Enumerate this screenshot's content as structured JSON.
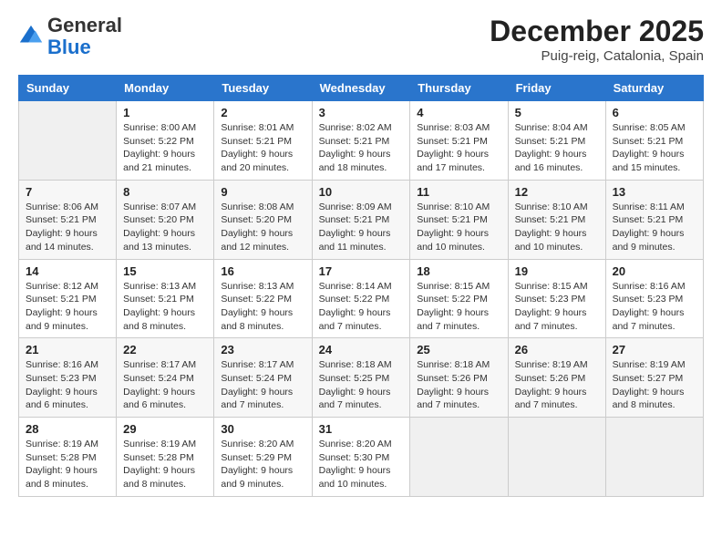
{
  "logo": {
    "general": "General",
    "blue": "Blue"
  },
  "title": "December 2025",
  "location": "Puig-reig, Catalonia, Spain",
  "weekdays": [
    "Sunday",
    "Monday",
    "Tuesday",
    "Wednesday",
    "Thursday",
    "Friday",
    "Saturday"
  ],
  "weeks": [
    [
      {
        "day": "",
        "info": ""
      },
      {
        "day": "1",
        "info": "Sunrise: 8:00 AM\nSunset: 5:22 PM\nDaylight: 9 hours\nand 21 minutes."
      },
      {
        "day": "2",
        "info": "Sunrise: 8:01 AM\nSunset: 5:21 PM\nDaylight: 9 hours\nand 20 minutes."
      },
      {
        "day": "3",
        "info": "Sunrise: 8:02 AM\nSunset: 5:21 PM\nDaylight: 9 hours\nand 18 minutes."
      },
      {
        "day": "4",
        "info": "Sunrise: 8:03 AM\nSunset: 5:21 PM\nDaylight: 9 hours\nand 17 minutes."
      },
      {
        "day": "5",
        "info": "Sunrise: 8:04 AM\nSunset: 5:21 PM\nDaylight: 9 hours\nand 16 minutes."
      },
      {
        "day": "6",
        "info": "Sunrise: 8:05 AM\nSunset: 5:21 PM\nDaylight: 9 hours\nand 15 minutes."
      }
    ],
    [
      {
        "day": "7",
        "info": "Sunrise: 8:06 AM\nSunset: 5:21 PM\nDaylight: 9 hours\nand 14 minutes."
      },
      {
        "day": "8",
        "info": "Sunrise: 8:07 AM\nSunset: 5:20 PM\nDaylight: 9 hours\nand 13 minutes."
      },
      {
        "day": "9",
        "info": "Sunrise: 8:08 AM\nSunset: 5:20 PM\nDaylight: 9 hours\nand 12 minutes."
      },
      {
        "day": "10",
        "info": "Sunrise: 8:09 AM\nSunset: 5:21 PM\nDaylight: 9 hours\nand 11 minutes."
      },
      {
        "day": "11",
        "info": "Sunrise: 8:10 AM\nSunset: 5:21 PM\nDaylight: 9 hours\nand 10 minutes."
      },
      {
        "day": "12",
        "info": "Sunrise: 8:10 AM\nSunset: 5:21 PM\nDaylight: 9 hours\nand 10 minutes."
      },
      {
        "day": "13",
        "info": "Sunrise: 8:11 AM\nSunset: 5:21 PM\nDaylight: 9 hours\nand 9 minutes."
      }
    ],
    [
      {
        "day": "14",
        "info": "Sunrise: 8:12 AM\nSunset: 5:21 PM\nDaylight: 9 hours\nand 9 minutes."
      },
      {
        "day": "15",
        "info": "Sunrise: 8:13 AM\nSunset: 5:21 PM\nDaylight: 9 hours\nand 8 minutes."
      },
      {
        "day": "16",
        "info": "Sunrise: 8:13 AM\nSunset: 5:22 PM\nDaylight: 9 hours\nand 8 minutes."
      },
      {
        "day": "17",
        "info": "Sunrise: 8:14 AM\nSunset: 5:22 PM\nDaylight: 9 hours\nand 7 minutes."
      },
      {
        "day": "18",
        "info": "Sunrise: 8:15 AM\nSunset: 5:22 PM\nDaylight: 9 hours\nand 7 minutes."
      },
      {
        "day": "19",
        "info": "Sunrise: 8:15 AM\nSunset: 5:23 PM\nDaylight: 9 hours\nand 7 minutes."
      },
      {
        "day": "20",
        "info": "Sunrise: 8:16 AM\nSunset: 5:23 PM\nDaylight: 9 hours\nand 7 minutes."
      }
    ],
    [
      {
        "day": "21",
        "info": "Sunrise: 8:16 AM\nSunset: 5:23 PM\nDaylight: 9 hours\nand 6 minutes."
      },
      {
        "day": "22",
        "info": "Sunrise: 8:17 AM\nSunset: 5:24 PM\nDaylight: 9 hours\nand 6 minutes."
      },
      {
        "day": "23",
        "info": "Sunrise: 8:17 AM\nSunset: 5:24 PM\nDaylight: 9 hours\nand 7 minutes."
      },
      {
        "day": "24",
        "info": "Sunrise: 8:18 AM\nSunset: 5:25 PM\nDaylight: 9 hours\nand 7 minutes."
      },
      {
        "day": "25",
        "info": "Sunrise: 8:18 AM\nSunset: 5:26 PM\nDaylight: 9 hours\nand 7 minutes."
      },
      {
        "day": "26",
        "info": "Sunrise: 8:19 AM\nSunset: 5:26 PM\nDaylight: 9 hours\nand 7 minutes."
      },
      {
        "day": "27",
        "info": "Sunrise: 8:19 AM\nSunset: 5:27 PM\nDaylight: 9 hours\nand 8 minutes."
      }
    ],
    [
      {
        "day": "28",
        "info": "Sunrise: 8:19 AM\nSunset: 5:28 PM\nDaylight: 9 hours\nand 8 minutes."
      },
      {
        "day": "29",
        "info": "Sunrise: 8:19 AM\nSunset: 5:28 PM\nDaylight: 9 hours\nand 8 minutes."
      },
      {
        "day": "30",
        "info": "Sunrise: 8:20 AM\nSunset: 5:29 PM\nDaylight: 9 hours\nand 9 minutes."
      },
      {
        "day": "31",
        "info": "Sunrise: 8:20 AM\nSunset: 5:30 PM\nDaylight: 9 hours\nand 10 minutes."
      },
      {
        "day": "",
        "info": ""
      },
      {
        "day": "",
        "info": ""
      },
      {
        "day": "",
        "info": ""
      }
    ]
  ]
}
